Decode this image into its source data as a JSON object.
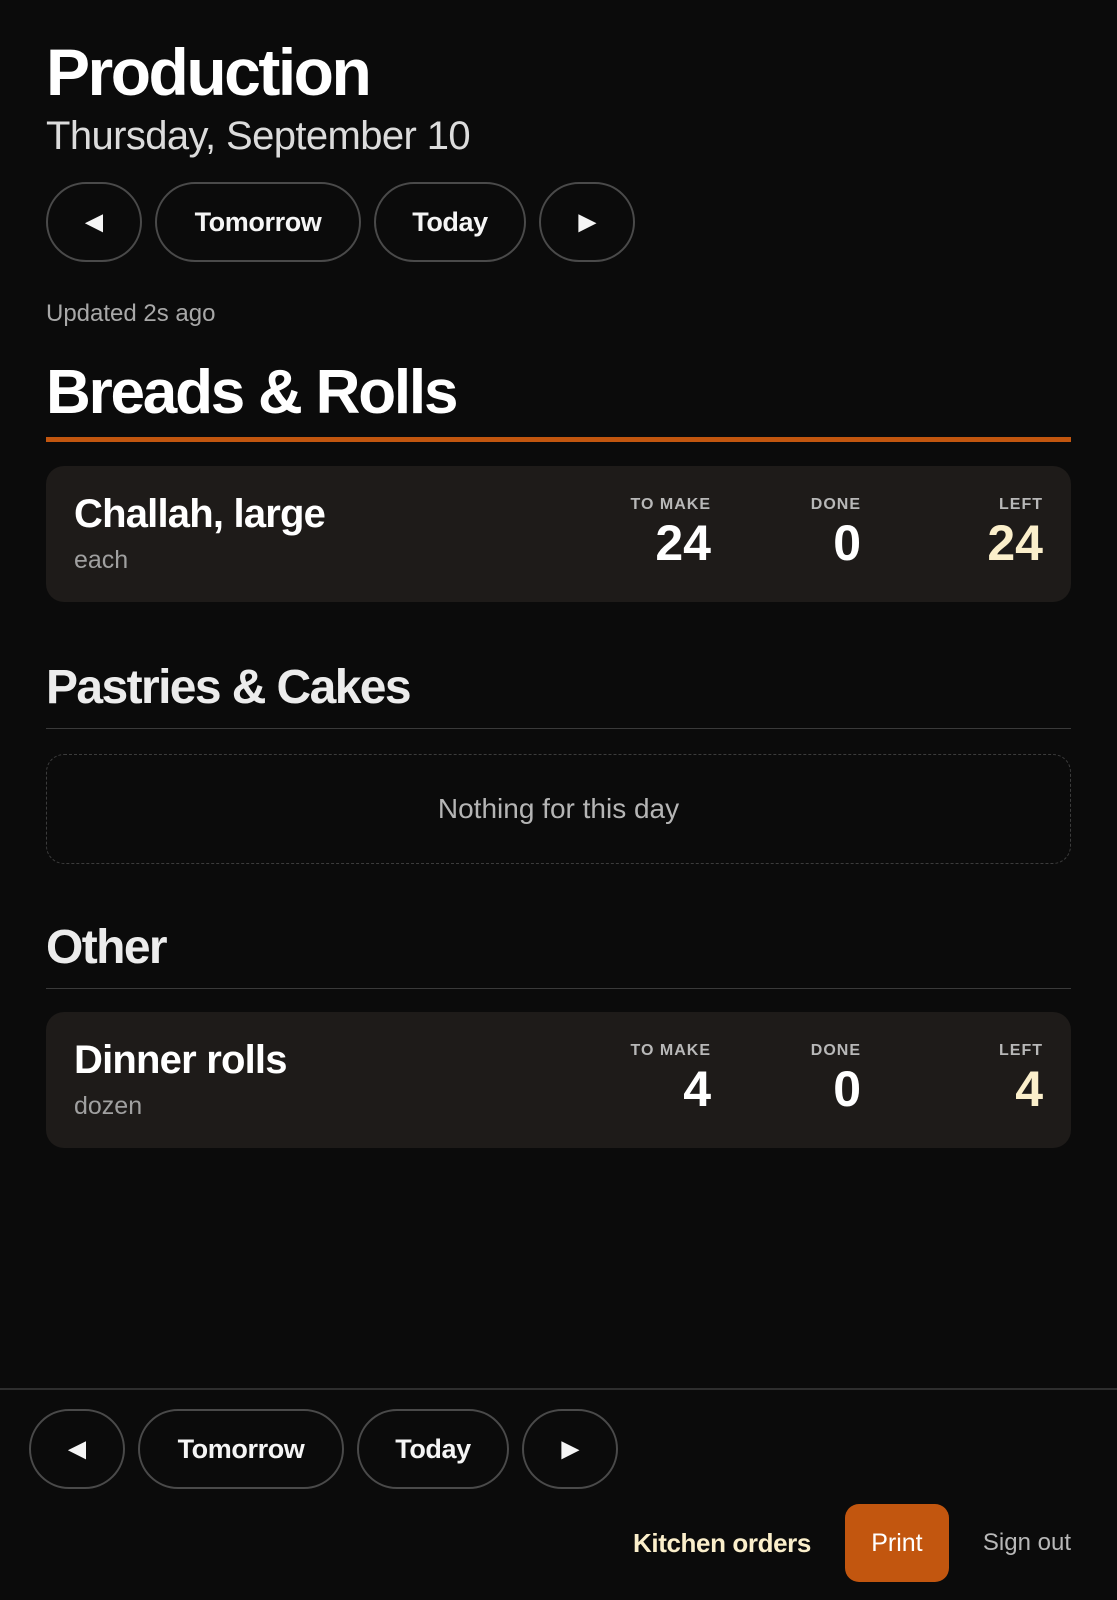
{
  "header": {
    "title": "Production",
    "date": "Thursday, September 10",
    "updated": "Updated 2s ago"
  },
  "nav": {
    "prev_icon": "◀",
    "tomorrow_label": "Tomorrow",
    "today_label": "Today",
    "next_icon": "▶"
  },
  "stat_labels": {
    "to_make": "TO MAKE",
    "done": "DONE",
    "left": "LEFT"
  },
  "sections": [
    {
      "title": "Breads & Rolls",
      "items": [
        {
          "name": "Challah, large",
          "unit": "each",
          "to_make": "24",
          "done": "0",
          "left": "24"
        }
      ]
    },
    {
      "title": "Pastries & Cakes",
      "empty_text": "Nothing for this day"
    },
    {
      "title": "Other",
      "items": [
        {
          "name": "Dinner rolls",
          "unit": "dozen",
          "to_make": "4",
          "done": "0",
          "left": "4"
        }
      ]
    }
  ],
  "footer": {
    "kitchen_orders": "Kitchen orders",
    "print": "Print",
    "sign_out": "Sign out"
  },
  "colors": {
    "accent": "#c2560f",
    "background": "#0b0b0b",
    "card": "#1e1b19",
    "highlight_text": "#fbefcb"
  }
}
